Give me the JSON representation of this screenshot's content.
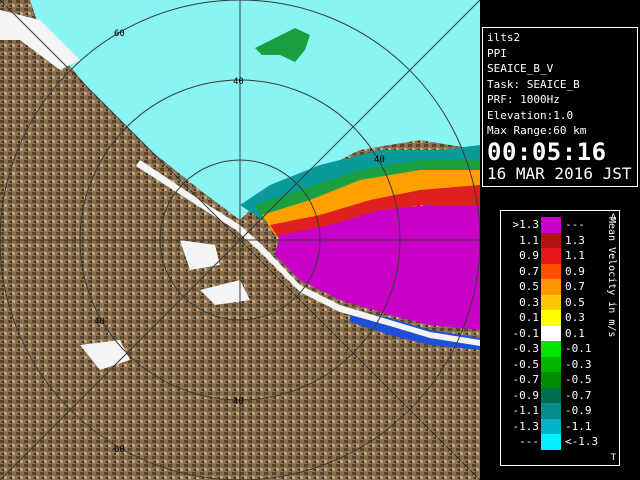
{
  "info": {
    "site": "ilts2",
    "mode": "PPI",
    "product": "SEAICE_B_V",
    "task": "Task: SEAICE_B",
    "prf": "PRF: 1000Hz",
    "elevation": "Elevation:1.0",
    "max_range": "Max Range:60 km",
    "time": "00:05:16",
    "date": "16 MAR 2016 JST"
  },
  "legend": {
    "title": "Mean Velocity in m/s",
    "top_mark": "A",
    "bottom_mark": "T",
    "rows": [
      {
        "left": ">1.3",
        "right": "---",
        "color": "#c800c8"
      },
      {
        "left": "1.1",
        "right": "1.3",
        "color": "#b01414"
      },
      {
        "left": "0.9",
        "right": "1.1",
        "color": "#e81818"
      },
      {
        "left": "0.7",
        "right": "0.9",
        "color": "#ff5000"
      },
      {
        "left": "0.5",
        "right": "0.7",
        "color": "#ff9600"
      },
      {
        "left": "0.3",
        "right": "0.5",
        "color": "#ffc800"
      },
      {
        "left": "0.1",
        "right": "0.3",
        "color": "#ffff00"
      },
      {
        "left": "-0.1",
        "right": "0.1",
        "color": "#ffffff"
      },
      {
        "left": "-0.3",
        "right": "-0.1",
        "color": "#00e600"
      },
      {
        "left": "-0.5",
        "right": "-0.3",
        "color": "#00b400"
      },
      {
        "left": "-0.7",
        "right": "-0.5",
        "color": "#008c00"
      },
      {
        "left": "-0.9",
        "right": "-0.7",
        "color": "#006e50"
      },
      {
        "left": "-1.1",
        "right": "-0.9",
        "color": "#0a8c8c"
      },
      {
        "left": "-1.3",
        "right": "-1.1",
        "color": "#00b4c8"
      },
      {
        "left": "---",
        "right": "<-1.3",
        "color": "#00f0ff"
      }
    ]
  },
  "map": {
    "ring_labels": [
      "60",
      "40",
      "40",
      "40",
      "40",
      "60"
    ],
    "colors": {
      "terrain": "#8a7050",
      "sea_echo": "#88f4f4",
      "positive": "#c800c8"
    }
  }
}
